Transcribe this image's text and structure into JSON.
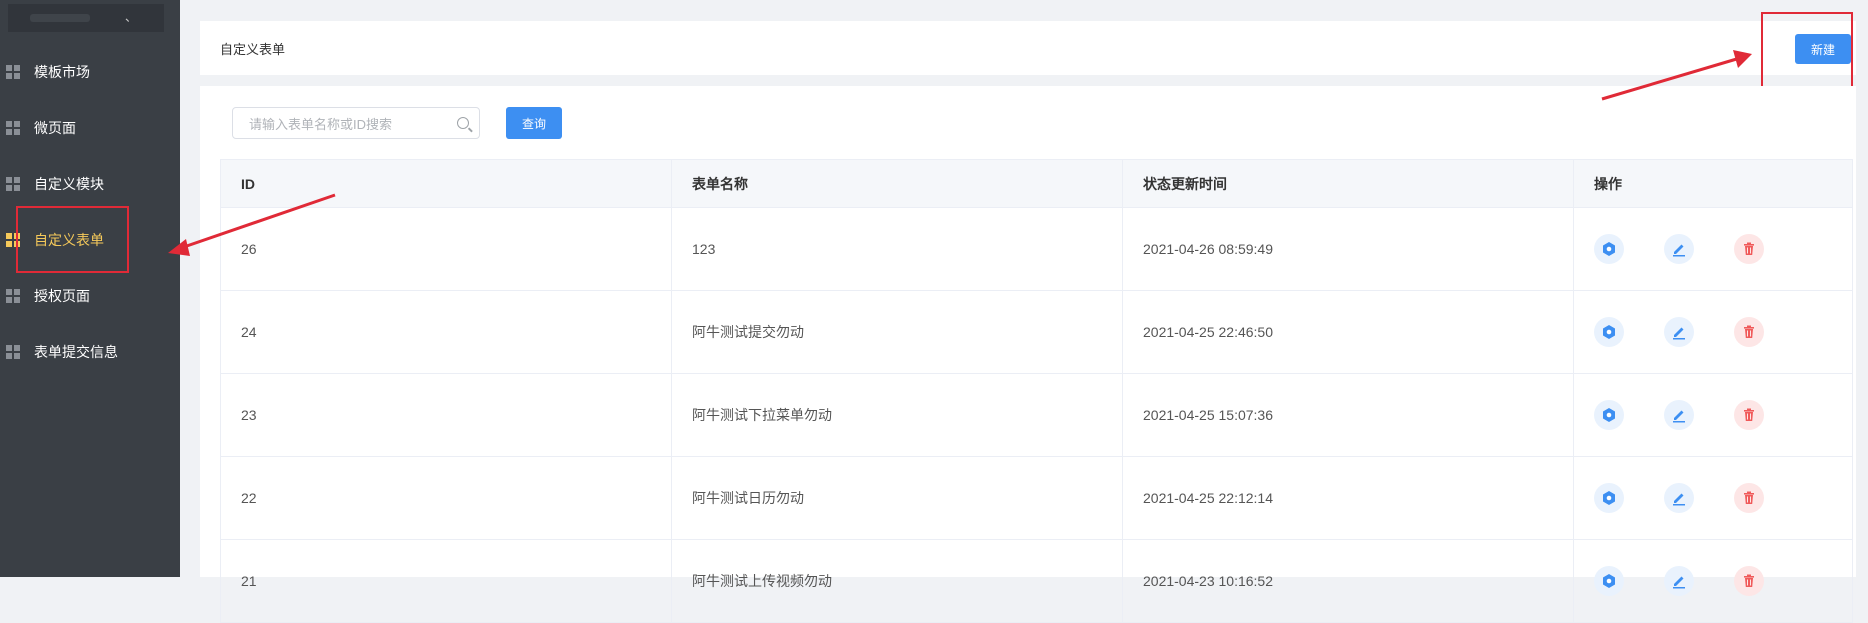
{
  "sidebar": {
    "items": [
      {
        "label": "模板市场",
        "active": false
      },
      {
        "label": "微页面",
        "active": false
      },
      {
        "label": "自定义模块",
        "active": false
      },
      {
        "label": "自定义表单",
        "active": true
      },
      {
        "label": "授权页面",
        "active": false
      },
      {
        "label": "表单提交信息",
        "active": false
      }
    ],
    "top_glyph": "、"
  },
  "header": {
    "title": "自定义表单",
    "new_button": "新建"
  },
  "search": {
    "placeholder": "请输入表单名称或ID搜索",
    "value": "",
    "query_button": "查询"
  },
  "table": {
    "columns": [
      "ID",
      "表单名称",
      "状态更新时间",
      "操作"
    ],
    "rows": [
      {
        "id": "26",
        "name": "123",
        "updated": "2021-04-26 08:59:49"
      },
      {
        "id": "24",
        "name": "阿牛测试提交勿动",
        "updated": "2021-04-25 22:46:50"
      },
      {
        "id": "23",
        "name": "阿牛测试下拉菜单勿动",
        "updated": "2021-04-25 15:07:36"
      },
      {
        "id": "22",
        "name": "阿牛测试日历勿动",
        "updated": "2021-04-25 22:12:14"
      },
      {
        "id": "21",
        "name": "阿牛测试上传视频勿动",
        "updated": "2021-04-23 10:16:52"
      }
    ]
  },
  "colors": {
    "accent": "#3d8ff2",
    "sidebar_bg": "#3a3f45",
    "active": "#f5c95a",
    "annotation": "#e02a37",
    "delete": "#f05a5a"
  },
  "icons": {
    "view": "hexagon-icon",
    "edit": "pencil-icon",
    "delete": "trash-icon"
  }
}
